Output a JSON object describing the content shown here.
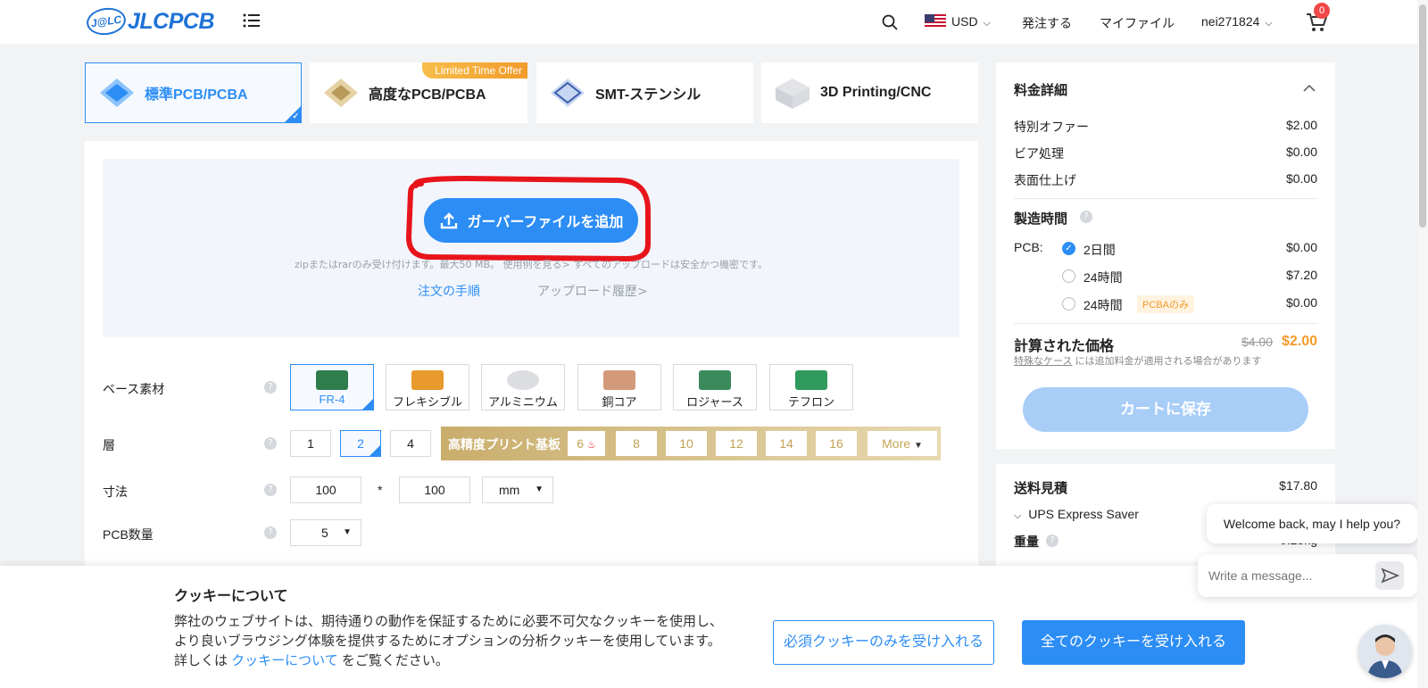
{
  "header": {
    "logo_badge": "J@LC",
    "logo_text": "JLCPCB",
    "currency": "USD",
    "order": "発注する",
    "my_files": "マイファイル",
    "username": "nei271824",
    "cart_count": "0"
  },
  "tabs": [
    {
      "label": "標準PCB/PCBA"
    },
    {
      "label": "高度なPCB/PCBA",
      "badge": "Limited Time Offer"
    },
    {
      "label": "SMT-ステンシル"
    },
    {
      "label": "3D Printing/CNC"
    }
  ],
  "upload": {
    "button": "ガーバーファイルを追加",
    "note": "zipまたはrarのみ受け付けます。最大50 MB。 使用例を見る>  すべてのアップロードは安全かつ機密です。",
    "order_steps": "注文の手順",
    "history": "アップロード履歴>"
  },
  "form": {
    "base_material": {
      "label": "ベース素材",
      "options": [
        "FR-4",
        "フレキシブル",
        "アルミニウム",
        "銅コア",
        "ロジャース",
        "テフロン"
      ]
    },
    "layers": {
      "label": "層",
      "options": [
        "1",
        "2",
        "4"
      ],
      "hd_title": "高精度プリント基板",
      "hd_options": [
        "6",
        "8",
        "10",
        "12",
        "14",
        "16"
      ],
      "more": "More"
    },
    "dimensions": {
      "label": "寸法",
      "width": "100",
      "sep": "*",
      "height": "100",
      "unit": "mm"
    },
    "quantity": {
      "label": "PCB数量",
      "value": "5"
    }
  },
  "price": {
    "title": "料金詳細",
    "rows": [
      {
        "label": "特別オファー",
        "value": "$2.00"
      },
      {
        "label": "ビア処理",
        "value": "$0.00"
      },
      {
        "label": "表面仕上げ",
        "value": "$0.00"
      }
    ],
    "build_time_title": "製造時間",
    "pcb_label": "PCB:",
    "build_options": [
      {
        "label": "2日間",
        "value": "$0.00"
      },
      {
        "label": "24時間",
        "value": "$7.20"
      },
      {
        "label": "24時間",
        "value": "$0.00",
        "badge": "PCBAのみ"
      }
    ],
    "calc_title": "計算された価格",
    "old_price": "$4.00",
    "new_price": "$2.00",
    "special_note_link": "特殊なケース",
    "special_note_rest": "には追加料金が適用される場合があります",
    "save_cart": "カートに保存"
  },
  "shipping": {
    "title": "送料見積",
    "value": "$17.80",
    "method": "UPS Express Saver",
    "weight_label": "重量",
    "weight_value": "0.28kg"
  },
  "cookie": {
    "title": "クッキーについて",
    "text_before": "弊社のウェブサイトは、期待通りの動作を保証するために必要不可欠なクッキーを使用し、より良いブラウジング体験を提供するためにオプションの分析クッキーを使用しています。詳しくは ",
    "link": "クッキーについて",
    "text_after": " をご覧ください。",
    "btn_necessary": "必須クッキーのみを受け入れる",
    "btn_all": "全てのクッキーを受け入れる"
  },
  "chat": {
    "greeting": "Welcome back, may I help you?",
    "placeholder": "Write a message..."
  },
  "colors": {
    "accent": "#2c8df5",
    "orange": "#f29b2a",
    "annotation": "#e8141c"
  }
}
